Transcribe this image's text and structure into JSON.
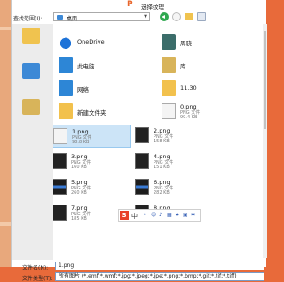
{
  "dialog": {
    "title": "选择纹理"
  },
  "toolbar": {
    "lookin_label": "查找范围(I):",
    "lookin_value": "桌面"
  },
  "items": [
    {
      "name": "OneDrive",
      "icon": "onedrive-icon"
    },
    {
      "name": "周骁",
      "icon": "user-folder-icon"
    },
    {
      "name": "此电脑",
      "icon": "this-pc-icon"
    },
    {
      "name": "库",
      "icon": "library-icon"
    },
    {
      "name": "网络",
      "icon": "network-icon"
    },
    {
      "name": "11.30",
      "icon": "folder-icon"
    },
    {
      "name": "新建文件夹",
      "icon": "folder-icon"
    },
    {
      "name": "0.png",
      "type": "PNG 文件",
      "size": "99.4 KB",
      "icon": "image-thumbnail-icon"
    },
    {
      "name": "1.png",
      "type": "PNG 文件",
      "size": "98.8 KB",
      "icon": "image-thumbnail-icon",
      "selected": true
    },
    {
      "name": "2.png",
      "type": "PNG 文件",
      "size": "158 KB",
      "icon": "image-thumbnail-icon"
    },
    {
      "name": "3.png",
      "type": "PNG 文件",
      "size": "160 KB",
      "icon": "image-thumbnail-icon"
    },
    {
      "name": "4.png",
      "type": "PNG 文件",
      "size": "151 KB",
      "icon": "image-thumbnail-icon"
    },
    {
      "name": "5.png",
      "type": "PNG 文件",
      "size": "260 KB",
      "icon": "image-thumbnail-icon"
    },
    {
      "name": "6.png",
      "type": "PNG 文件",
      "size": "282 KB",
      "icon": "image-thumbnail-icon"
    },
    {
      "name": "7.png",
      "type": "PNG 文件",
      "size": "185 KB",
      "icon": "image-thumbnail-icon"
    },
    {
      "name": "8.png",
      "type": "",
      "size": "",
      "icon": "image-thumbnail-icon"
    }
  ],
  "ime": {
    "logo": "S",
    "lang": "中"
  },
  "filename": {
    "label": "文件名(N):",
    "value": "1.png"
  },
  "filetype": {
    "label": "文件类型(T):",
    "value": "所有图片 (*.emf;*.wmf;*.jpg;*.jpeg;*.jpe;*.png;*.bmp;*.gif;*.tif;*.tiff)"
  },
  "colors": {
    "accent": "#e8662c",
    "selection": "#cce4f7",
    "folder": "#f2c14d"
  }
}
